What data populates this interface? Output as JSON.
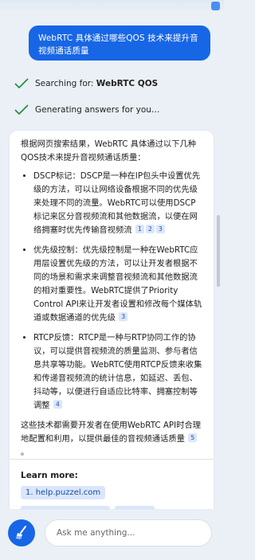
{
  "user_message": "WebRTC 具体通过哪些QOS 技术来提升音视频通话质量",
  "status": {
    "searching_prefix": "Searching for: ",
    "searching_query": "WebRTC QOS",
    "generating": "Generating answers for you…"
  },
  "answer": {
    "intro": "根据网页搜索结果，WebRTC 具体通过以下几种QOS技术来提升音视频通话质量：",
    "items": [
      {
        "text": "DSCP标记：DSCP是一种在IP包头中设置优先级的方法，可以让网络设备根据不同的优先级来处理不同的流量。WebRTC可以使用DSCP标记来区分音视频流和其他数据流，以便在网络拥塞时优先传输音视频流",
        "cites": [
          "1",
          "2",
          "3"
        ]
      },
      {
        "text": "优先级控制：优先级控制是一种在WebRTC应用层设置优先级的方法，可以让开发者根据不同的场景和需求来调整音视频流和其他数据流的相对重要性。WebRTC提供了Priority Control API来让开发者设置和修改每个媒体轨道或数据通道的优先级",
        "cites": [
          "3"
        ]
      },
      {
        "text": "RTCP反馈：RTCP是一种与RTP协同工作的协议，可以提供音视频流的质量监测、参与者信息共享等功能。WebRTC使用RTCP反馈来收集和传递音视频流的统计信息，如延迟、丢包、抖动等，以便进行自适应比特率、拥塞控制等调整",
        "cites": [
          "4"
        ]
      }
    ],
    "outro": "这些技术都需要开发者在使用WebRTC API时合理地配置和利用，以提供最佳的音视频通话质量",
    "outro_cites": [
      "5"
    ],
    "outro_end": "。"
  },
  "learn_more": {
    "title": "Learn more:",
    "links": [
      "1. help.puzzel.com"
    ]
  },
  "input": {
    "placeholder": "Ask me anything..."
  },
  "colors": {
    "accent": "#1766e6",
    "check": "#1f8a3a",
    "cite_bg": "#dbe6fb"
  },
  "icons": [
    "check-icon",
    "broom-icon",
    "window-button-icon"
  ]
}
